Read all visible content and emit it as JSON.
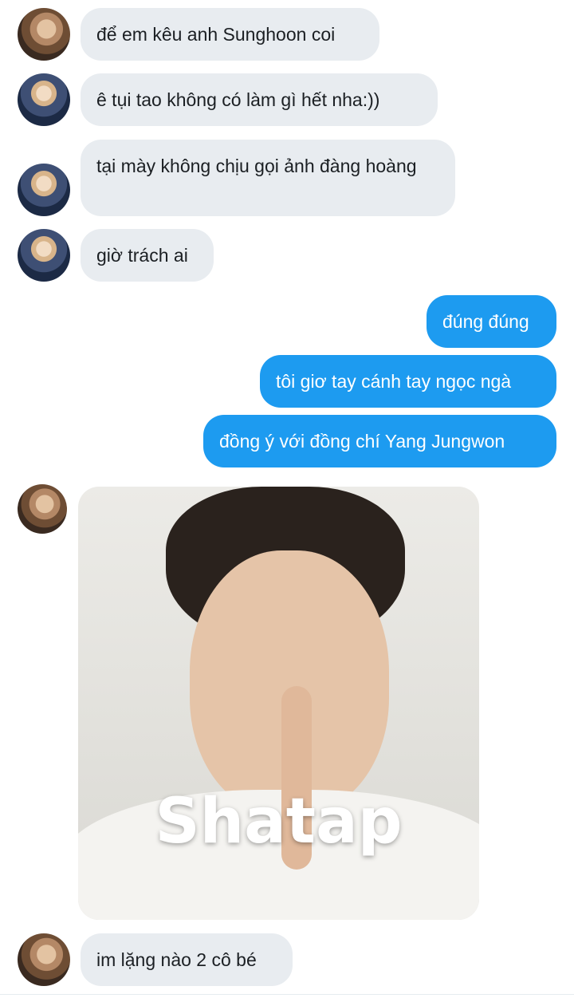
{
  "messages": [
    {
      "text": "để em kêu anh Sunghoon coi"
    },
    {
      "text": "ê tụi tao không có làm gì hết nha:))"
    },
    {
      "text": "tại mày không chịu gọi ảnh đàng hoàng"
    },
    {
      "text": "giờ trách ai"
    },
    {
      "text": "đúng đúng"
    },
    {
      "text": "tôi giơ tay cánh tay ngọc ngà"
    },
    {
      "text": "đồng ý với đồng chí Yang Jungwon"
    },
    {
      "text": "im lặng nào 2 cô bé"
    }
  ],
  "image_message": {
    "overlay_text": "Shatap"
  },
  "colors": {
    "incoming_bubble": "#e8ecf0",
    "outgoing_bubble": "#1d9bf0"
  }
}
